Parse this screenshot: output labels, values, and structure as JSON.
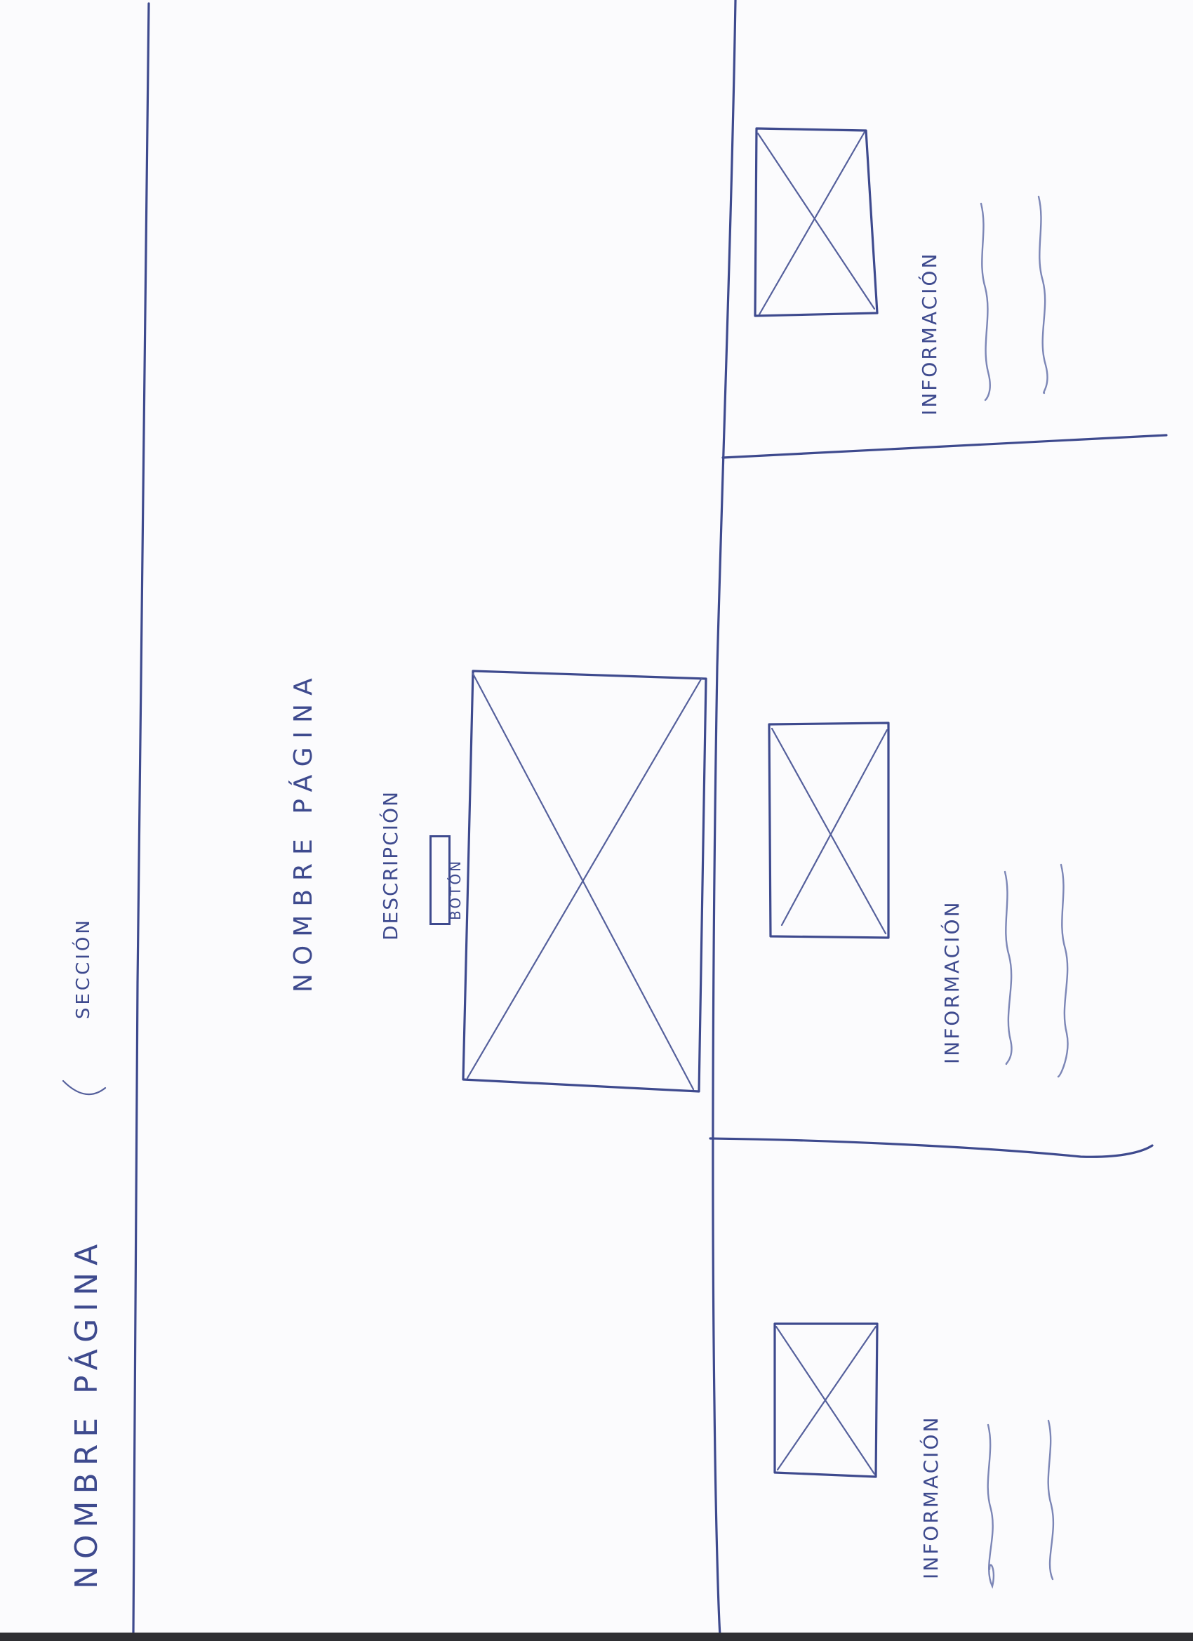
{
  "site": {
    "name": "NOMBRE PÁGINA",
    "section": "SECCIÓN"
  },
  "hero": {
    "title": "NOMBRE PÁGINA",
    "description": "DESCRIPCIÓN",
    "button": "BOTÓN",
    "image_icon": "image-placeholder-icon"
  },
  "cards": [
    {
      "label": "INFORMACIÓN",
      "image_icon": "image-placeholder-icon"
    },
    {
      "label": "INFORMACIÓN",
      "image_icon": "image-placeholder-icon"
    },
    {
      "label": "INFORMACIÓN",
      "image_icon": "image-placeholder-icon"
    }
  ],
  "colors": {
    "ink": "#3e4a8e",
    "paper": "#fbfbfd"
  }
}
